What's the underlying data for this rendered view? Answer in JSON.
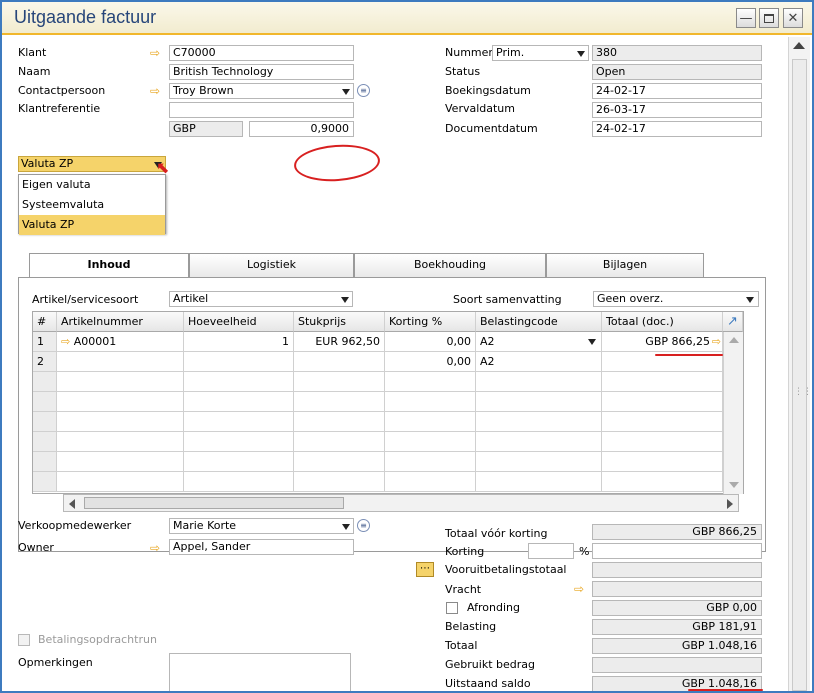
{
  "window": {
    "title": "Uitgaande factuur"
  },
  "header_left": {
    "klant_label": "Klant",
    "klant_value": "C70000",
    "naam_label": "Naam",
    "naam_value": "British Technology",
    "contact_label": "Contactpersoon",
    "contact_value": "Troy Brown",
    "klantref_label": "Klantreferentie",
    "klantref_value": "",
    "valuta_label": "Valuta ZP",
    "valuta_code": "GBP",
    "valuta_rate": "0,9000",
    "currency_options": [
      "Eigen valuta",
      "Systeemvaluta",
      "Valuta ZP"
    ],
    "currency_selected": "Valuta ZP"
  },
  "header_right": {
    "nummer_label": "Nummer",
    "nummer_series": "Prim.",
    "nummer_value": "380",
    "status_label": "Status",
    "status_value": "Open",
    "boekingsdatum_label": "Boekingsdatum",
    "boekingsdatum_value": "24-02-17",
    "vervaldatum_label": "Vervaldatum",
    "vervaldatum_value": "26-03-17",
    "documentdatum_label": "Documentdatum",
    "documentdatum_value": "24-02-17"
  },
  "tabs": [
    {
      "label": "Inhoud"
    },
    {
      "label": "Logistiek"
    },
    {
      "label": "Boekhouding"
    },
    {
      "label": "Bijlagen"
    }
  ],
  "inhoud": {
    "artikeltype_label": "Artikel/servicesoort",
    "artikeltype_value": "Artikel",
    "samenvatting_label": "Soort samenvatting",
    "samenvatting_value": "Geen overz.",
    "columns": [
      "#",
      "Artikelnummer",
      "Hoeveelheid",
      "Stukprijs",
      "Korting %",
      "Belastingcode",
      "Totaal (doc.)"
    ],
    "rows": [
      {
        "num": "1",
        "artikel": "A00001",
        "hoeveelheid": "1",
        "stukprijs": "EUR 962,50",
        "korting": "0,00",
        "belasting": "A2",
        "totaal": "GBP 866,25"
      },
      {
        "num": "2",
        "artikel": "",
        "hoeveelheid": "",
        "stukprijs": "",
        "korting": "0,00",
        "belasting": "A2",
        "totaal": ""
      }
    ]
  },
  "footer_left": {
    "verkoop_label": "Verkoopmedewerker",
    "verkoop_value": "Marie Korte",
    "owner_label": "Owner",
    "owner_value": "Appel, Sander",
    "betaling_label": "Betalingsopdrachtrun",
    "opmerkingen_label": "Opmerkingen"
  },
  "totals": {
    "voor_korting_label": "Totaal vóór korting",
    "voor_korting_value": "GBP 866,25",
    "korting_label": "Korting",
    "korting_pct": "",
    "pct_symbol": "%",
    "korting_value": "",
    "vooruit_label": "Vooruitbetalingstotaal",
    "vooruit_value": "",
    "vracht_label": "Vracht",
    "vracht_value": "",
    "afronding_label": "Afronding",
    "afronding_value": "GBP 0,00",
    "belasting_label": "Belasting",
    "belasting_value": "GBP 181,91",
    "totaal_label": "Totaal",
    "totaal_value": "GBP 1.048,16",
    "gebruikt_label": "Gebruikt bedrag",
    "gebruikt_value": "",
    "uitstaand_label": "Uitstaand saldo",
    "uitstaand_value": "GBP 1.048,16"
  },
  "colors": {
    "accent": "#f1b72c",
    "title_text": "#27467a",
    "annotation": "#d82020"
  }
}
